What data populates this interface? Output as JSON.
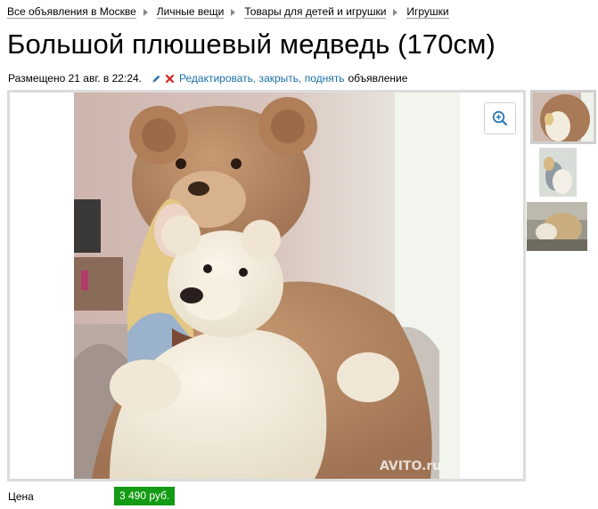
{
  "breadcrumbs": [
    {
      "label": "Все объявления в Москве"
    },
    {
      "label": "Личные вещи"
    },
    {
      "label": "Товары для детей и игрушки"
    },
    {
      "label": "Игрушки"
    }
  ],
  "title": "Большой плюшевый медведь (170см)",
  "meta": {
    "posted": "Размещено 21 авг. в 22:24.",
    "actions_link": "Редактировать, закрыть, поднять",
    "tail": "объявление"
  },
  "gallery": {
    "watermark": "AVITO.ru",
    "zoom_icon": "zoom-in-icon",
    "thumbnails": [
      {
        "name": "thumbnail-1",
        "active": true
      },
      {
        "name": "thumbnail-2",
        "active": false
      },
      {
        "name": "thumbnail-3",
        "active": false
      }
    ]
  },
  "price": {
    "label": "Цена",
    "value": "3 490 руб."
  },
  "colors": {
    "link": "#1a6fa8",
    "price_badge": "#139c13",
    "gallery_border": "#dcdcdc"
  }
}
